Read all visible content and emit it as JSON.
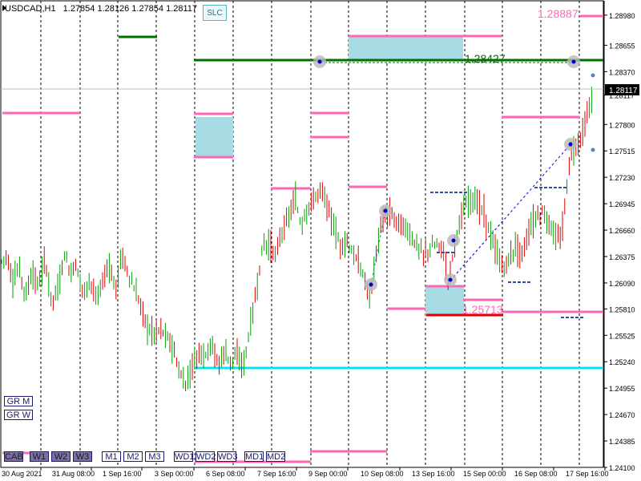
{
  "header": {
    "symbol": "USDCAD,H1",
    "ohlc": "1.27854  1.28126  1.27854  1.28117"
  },
  "slc_button": "SLC",
  "current_price": "1.28117",
  "labels": {
    "upper_pink": "1.28887",
    "green_level": "1.28427",
    "lower_pink": "1.25713"
  },
  "colors": {
    "candle_up": "#00a000",
    "candle_down": "#e00000",
    "green_line": "#007000",
    "pink": "#ff66b3",
    "cyan": "#00e5ff",
    "box_fill": "#a8dce4",
    "red_line": "#dd0000",
    "axis_text": "#000000",
    "price_box": "#000000"
  },
  "left_buttons": [
    "GR M",
    "GR W"
  ],
  "bottom_buttons": [
    "CAB",
    "W1",
    "W2",
    "W3",
    "M1",
    "M2",
    "M3",
    "WD1",
    "WD2",
    "WD3",
    "MD1",
    "MD2"
  ],
  "chart_data": {
    "type": "candlestick",
    "symbol": "USDCAD",
    "timeframe": "H1",
    "ylim": [
      1.241,
      1.291
    ],
    "y_ticks": [
      "1.28980",
      "1.28655",
      "1.28370",
      "1.28117",
      "1.27800",
      "1.27515",
      "1.27230",
      "1.26945",
      "1.26660",
      "1.26375",
      "1.26090",
      "1.25810",
      "1.25525",
      "1.25240",
      "1.24955",
      "1.24670",
      "1.24385",
      "1.24100"
    ],
    "x_ticks": [
      "30 Aug 2021",
      "31 Aug 08:00",
      "1 Sep 16:00",
      "3 Sep 00:00",
      "6 Sep 08:00",
      "7 Sep 16:00",
      "9 Sep 00:00",
      "10 Sep 08:00",
      "13 Sep 16:00",
      "15 Sep 00:00",
      "16 Sep 08:00",
      "17 Sep 16:00"
    ],
    "close_path": [
      [
        0,
        1.263
      ],
      [
        8,
        1.264
      ],
      [
        16,
        1.261
      ],
      [
        24,
        1.2625
      ],
      [
        32,
        1.2595
      ],
      [
        40,
        1.262
      ],
      [
        48,
        1.2605
      ],
      [
        56,
        1.2635
      ],
      [
        64,
        1.259
      ],
      [
        72,
        1.26
      ],
      [
        80,
        1.264
      ],
      [
        88,
        1.262
      ],
      [
        96,
        1.263
      ],
      [
        104,
        1.2595
      ],
      [
        112,
        1.2615
      ],
      [
        120,
        1.259
      ],
      [
        128,
        1.261
      ],
      [
        136,
        1.263
      ],
      [
        144,
        1.26
      ],
      [
        152,
        1.264
      ],
      [
        160,
        1.262
      ],
      [
        168,
        1.26
      ],
      [
        176,
        1.2585
      ],
      [
        184,
        1.256
      ],
      [
        192,
        1.2555
      ],
      [
        200,
        1.256
      ],
      [
        208,
        1.255
      ],
      [
        216,
        1.254
      ],
      [
        224,
        1.251
      ],
      [
        232,
        1.25
      ],
      [
        240,
        1.252
      ],
      [
        248,
        1.2535
      ],
      [
        256,
        1.253
      ],
      [
        264,
        1.2545
      ],
      [
        272,
        1.252
      ],
      [
        280,
        1.2535
      ],
      [
        288,
        1.2525
      ],
      [
        296,
        1.253
      ],
      [
        304,
        1.252
      ],
      [
        312,
        1.256
      ],
      [
        320,
        1.26
      ],
      [
        328,
        1.265
      ],
      [
        336,
        1.265
      ],
      [
        344,
        1.264
      ],
      [
        352,
        1.2665
      ],
      [
        360,
        1.268
      ],
      [
        368,
        1.27
      ],
      [
        376,
        1.267
      ],
      [
        384,
        1.269
      ],
      [
        392,
        1.27
      ],
      [
        400,
        1.271
      ],
      [
        408,
        1.2695
      ],
      [
        416,
        1.267
      ],
      [
        424,
        1.265
      ],
      [
        432,
        1.2655
      ],
      [
        440,
        1.264
      ],
      [
        448,
        1.263
      ],
      [
        456,
        1.261
      ],
      [
        462,
        1.2595
      ],
      [
        468,
        1.263
      ],
      [
        474,
        1.2665
      ],
      [
        480,
        1.268
      ],
      [
        488,
        1.2685
      ],
      [
        496,
        1.2675
      ],
      [
        504,
        1.267
      ],
      [
        512,
        1.266
      ],
      [
        520,
        1.265
      ],
      [
        528,
        1.264
      ],
      [
        536,
        1.2645
      ],
      [
        544,
        1.265
      ],
      [
        552,
        1.2648
      ],
      [
        560,
        1.261
      ],
      [
        566,
        1.2645
      ],
      [
        572,
        1.267
      ],
      [
        580,
        1.269
      ],
      [
        588,
        1.27
      ],
      [
        596,
        1.2695
      ],
      [
        604,
        1.2685
      ],
      [
        612,
        1.266
      ],
      [
        620,
        1.264
      ],
      [
        628,
        1.2625
      ],
      [
        636,
        1.2635
      ],
      [
        644,
        1.265
      ],
      [
        652,
        1.264
      ],
      [
        660,
        1.2665
      ],
      [
        668,
        1.268
      ],
      [
        676,
        1.2685
      ],
      [
        684,
        1.2675
      ],
      [
        692,
        1.266
      ],
      [
        700,
        1.2655
      ],
      [
        706,
        1.27
      ],
      [
        712,
        1.275
      ],
      [
        718,
        1.2755
      ],
      [
        724,
        1.2765
      ],
      [
        730,
        1.278
      ],
      [
        736,
        1.28
      ],
      [
        740,
        1.2812
      ]
    ]
  }
}
